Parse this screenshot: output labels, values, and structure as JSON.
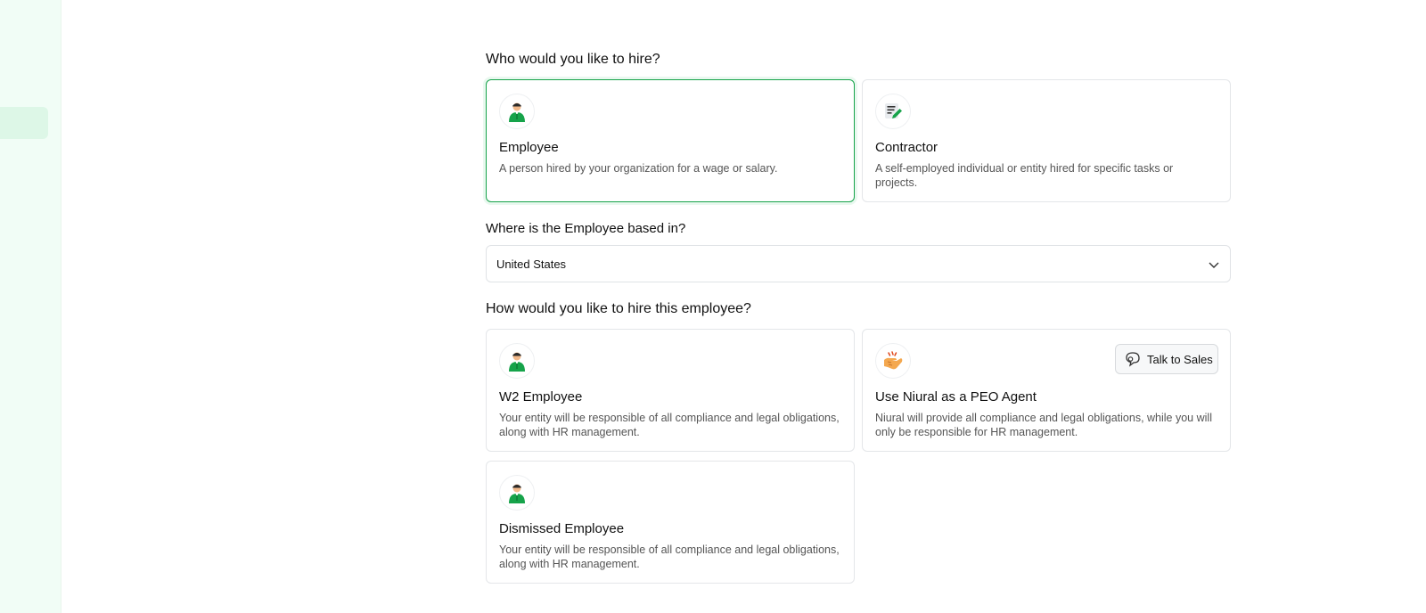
{
  "hire_type": {
    "question": "Who would you like to hire?",
    "options": [
      {
        "icon": "employee-icon",
        "title": "Employee",
        "description": "A person hired by your organization for a wage or salary.",
        "selected": true
      },
      {
        "icon": "contract-edit-icon",
        "title": "Contractor",
        "description": "A self-employed individual or entity hired for specific tasks or projects.",
        "selected": false
      }
    ]
  },
  "location": {
    "question": "Where is the Employee based in?",
    "selected_value": "United States"
  },
  "hire_method": {
    "question": "How would you like to hire this employee?",
    "options": [
      {
        "icon": "employee-icon",
        "title": "W2 Employee",
        "description": "Your entity will be responsible of all compliance and legal obligations, along with HR management."
      },
      {
        "icon": "handshake-icon",
        "title": "Use Niural as a PEO Agent",
        "description": "Niural will provide all compliance and legal obligations, while you will only be responsible for HR management.",
        "action_label": "Talk to Sales"
      },
      {
        "icon": "employee-icon",
        "title": "Dismissed Employee",
        "description": "Your entity will be responsible of all compliance and legal obligations, along with HR management."
      }
    ]
  },
  "colors": {
    "accent": "#16a34a",
    "sidebar": "#f1fdf6"
  }
}
